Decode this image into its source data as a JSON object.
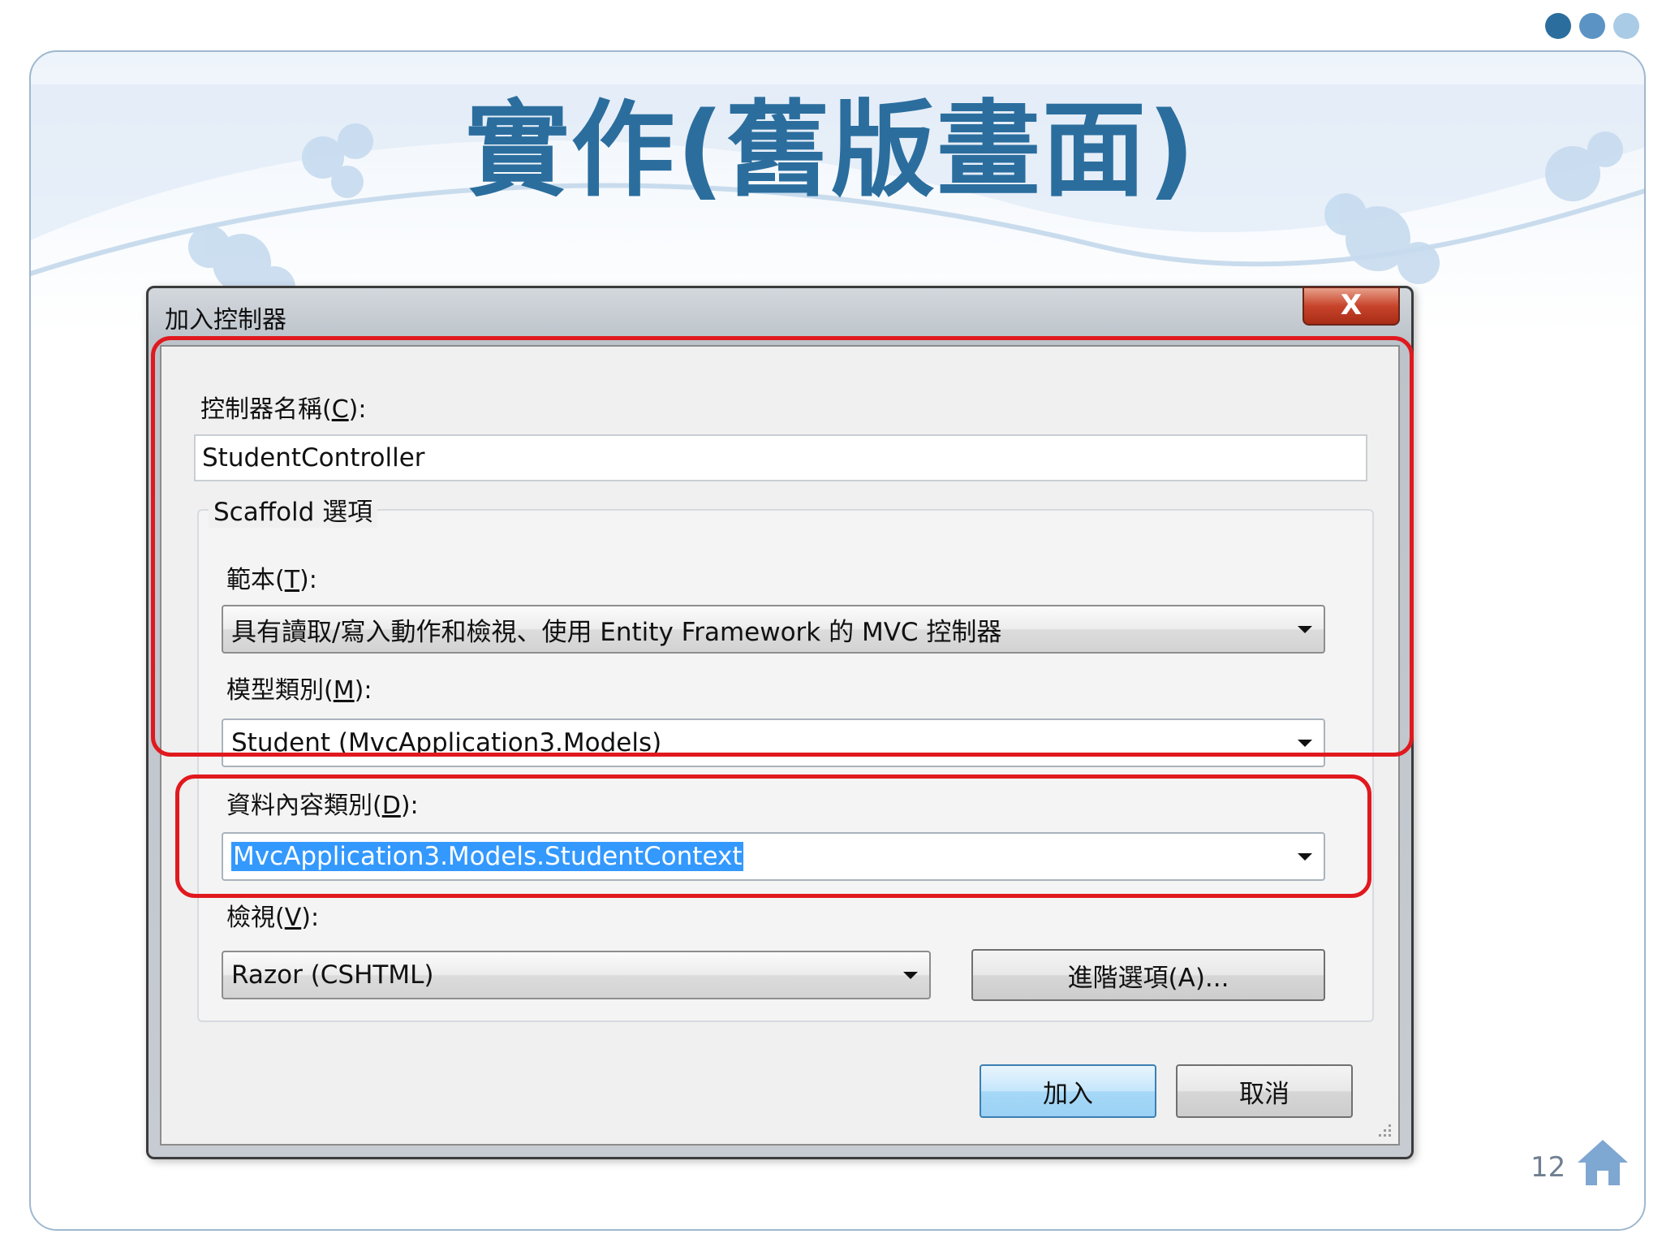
{
  "slide": {
    "title": "實作(舊版畫面)",
    "page_number": "12",
    "accent_color": "#2b6e9e",
    "dot_colors": [
      "#2b6e9e",
      "#5b93c4",
      "#a9cbe6"
    ]
  },
  "dialog": {
    "title": "加入控制器",
    "close_glyph": "X",
    "controller_name": {
      "label": "控制器名稱(",
      "accel": "C",
      "label_end": "):",
      "value": "StudentController"
    },
    "scaffold": {
      "legend": "Scaffold 選項",
      "template": {
        "label": "範本(",
        "accel": "T",
        "label_end": "):",
        "value": "具有讀取/寫入動作和檢視、使用 Entity Framework 的 MVC 控制器"
      },
      "model_class": {
        "label": "模型類別(",
        "accel": "M",
        "label_end": "):",
        "value": "Student (MvcApplication3.Models)"
      },
      "data_context": {
        "label": "資料內容類別(",
        "accel": "D",
        "label_end": "):",
        "value": "MvcApplication3.Models.StudentContext"
      },
      "views": {
        "label": "檢視(",
        "accel": "V",
        "label_end": "):",
        "value": "Razor (CSHTML)"
      },
      "advanced_button": "進階選項(A)..."
    },
    "add_button": "加入",
    "cancel_button": "取消"
  }
}
